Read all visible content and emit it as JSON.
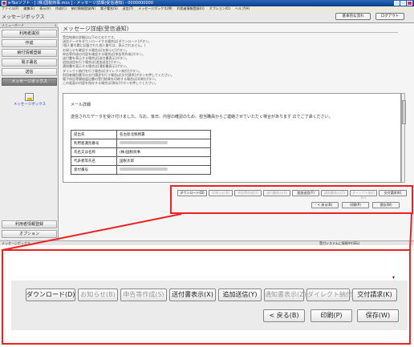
{
  "window": {
    "title": "e-Taxソフト - [ (株)国税商事.mcs ] - メッセージ詳細(受信通知) - 0000000000",
    "menu": [
      "ファイル(F)",
      "編集(E)",
      "表示(V)",
      "作成(C)",
      "納付情報登録(N)",
      "電子署名(S)",
      "送信(T)",
      "メッセージボックス(M)",
      "利用者情報登録(U)",
      "オプション(O)",
      "ヘルプ(H)"
    ]
  },
  "toolbar": {
    "app_name": "メッセージボックス",
    "buttons": [
      "基本的な流れ",
      "ログアウト"
    ]
  },
  "sidebar": {
    "header": "メニューボード",
    "close": "×",
    "items": [
      "利用者識別",
      "作成",
      "納付情報登録",
      "電子署名",
      "送信",
      "メッセージボックス"
    ],
    "selected_icon_label": "メッセージボックス",
    "bottom_items": [
      "利用者情報登録",
      "オプション"
    ]
  },
  "main": {
    "title": "メッセージ詳細(受信通知)",
    "description": [
      "受信結果の詳細は以下のとおりです。",
      "送信データをダウンロードする場合は[ダウンロード]ボタン。",
      "(個人番号欄に記載された個人番号は、表示されません。)",
      "お知らせを確認する場合は[お知らせ]ボタン。",
      "申告等作成の内容を確認する場合は[申告等作成]ボタン。",
      "送付書を表示する場合は[送付書表示]ボタン。",
      "追加送信を行う場合は[追加送信]ボタン。",
      "通知書を表示する場合は[通知書表示]ボタン。",
      "ダイレクト納付を行う場合は[ダイレクト納付]ボタン。",
      "利用者識別番号の交付請求を行う場合は[交付請求]ボタンを押してください。",
      "電子申告等開始届出書の受付結果を印刷する場合は[印刷]ボタン。",
      "この画面の内容を保存する場合は[保存]ボタンを押してください。"
    ],
    "content": {
      "title": "メール詳細",
      "note": "送信されたデータを受け付けました。なお、後日、内容の確認のため、担当職員からご連絡させていただく場合があります のでご了承ください。",
      "rows": [
        {
          "label": "提出先",
          "value": "名古屋北税務署"
        },
        {
          "label": "利用者識別番号",
          "value": ""
        },
        {
          "label": "氏名又は名称",
          "value": "(株)国税商事"
        },
        {
          "label": "代表者等氏名",
          "value": "国税太郎"
        },
        {
          "label": "受付番号",
          "value": ""
        }
      ]
    },
    "small_buttons_row1": [
      "ダウンロード(D)",
      "お知らせ(B)",
      "申告等作成(S)",
      "送付書表示(X)",
      "追加送信(Y)",
      "通知書表示(Z)",
      "ダイレクト納付(G)",
      "交付請求(K)"
    ],
    "small_buttons_row2": [
      "< 戻る(B)",
      "印刷(P)",
      "保存(W)"
    ]
  },
  "statusbar": {
    "left": "メッセージボックス",
    "right": "受付システムに接続中(SSL)"
  },
  "zoom": {
    "row1": [
      "ダウンロード(D)",
      "お知らせ(B)",
      "申告等作成(S)",
      "送付書表示(X)",
      "追加送信(Y)",
      "通知書表示(Z)",
      "ダイレクト納付(G)",
      "交付請求(K)"
    ],
    "row1_enabled": [
      true,
      false,
      false,
      true,
      true,
      false,
      false,
      true
    ],
    "row2": [
      "< 戻る(B)",
      "印刷(P)",
      "保存(W)"
    ],
    "arrow": "▾"
  },
  "colors": {
    "highlight": "#e22222",
    "titlebar": "#1a4fa0"
  }
}
